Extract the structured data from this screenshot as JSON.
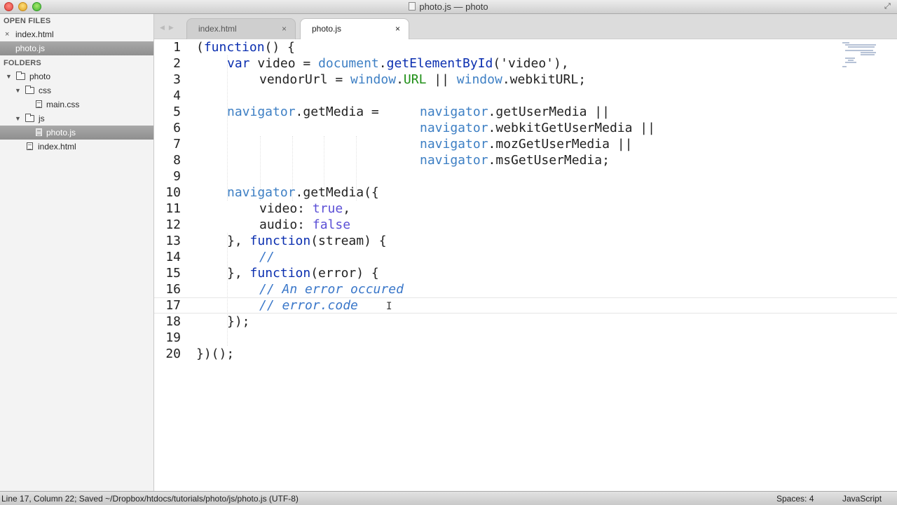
{
  "window": {
    "title": "photo.js — photo"
  },
  "sidebar": {
    "open_files_header": "OPEN FILES",
    "open_files": [
      {
        "label": "index.html",
        "selected": false
      },
      {
        "label": "photo.js",
        "selected": true
      }
    ],
    "folders_header": "FOLDERS",
    "tree": {
      "root": "photo",
      "css_folder": "css",
      "css_file": "main.css",
      "js_folder": "js",
      "js_file": "photo.js",
      "root_file": "index.html"
    }
  },
  "tabs": [
    {
      "label": "index.html",
      "active": false,
      "close": "×"
    },
    {
      "label": "photo.js",
      "active": true,
      "close": "×"
    }
  ],
  "editor": {
    "line_numbers": [
      "1",
      "2",
      "3",
      "4",
      "5",
      "6",
      "7",
      "8",
      "9",
      "10",
      "11",
      "12",
      "13",
      "14",
      "15",
      "16",
      "17",
      "18",
      "19",
      "20"
    ],
    "current_line": 17,
    "code": {
      "l1_a": "(",
      "l1_kw": "function",
      "l1_b": "() {",
      "l2_kw": "var",
      "l2_a": " video = ",
      "l2_obj": "document",
      "l2_b": ".",
      "l2_method": "getElementById",
      "l2_c": "('video'),",
      "l3_a": "vendorUrl = ",
      "l3_obj1": "window",
      "l3_b": ".",
      "l3_const": "URL",
      "l3_c": " || ",
      "l3_obj2": "window",
      "l3_d": ".webkitURL;",
      "l5_obj": "navigator",
      "l5_a": ".getMedia =    ",
      "l5_obj2": "navigator",
      "l5_b": ".getUserMedia ||",
      "l6_obj": "navigator",
      "l6_a": ".webkitGetUserMedia ||",
      "l7_obj": "navigator",
      "l7_a": ".mozGetUserMedia ||",
      "l8_obj": "navigator",
      "l8_a": ".msGetUserMedia;",
      "l10_obj": "navigator",
      "l10_a": ".getMedia({",
      "l11_a": "video: ",
      "l11_bool": "true",
      "l11_b": ",",
      "l12_a": "audio: ",
      "l12_bool": "false",
      "l13_a": "}, ",
      "l13_kw": "function",
      "l13_b": "(stream) {",
      "l14_cmt": "//",
      "l15_a": "}, ",
      "l15_kw": "function",
      "l15_b": "(error) {",
      "l16_cmt": "// An error occured",
      "l17_cmt": "// error.code",
      "l18_a": "});",
      "l20_a": "})();"
    }
  },
  "statusbar": {
    "left": "Line 17, Column 22; Saved ~/Dropbox/htdocs/tutorials/photo/js/photo.js (UTF-8)",
    "spaces": "Spaces: 4",
    "syntax": "JavaScript"
  },
  "colors": {
    "keyword": "#0b2fb0",
    "object": "#3d7fc4",
    "constant": "#1f8f17",
    "boolean": "#5b4fd6",
    "comment": "#3a77c9"
  }
}
